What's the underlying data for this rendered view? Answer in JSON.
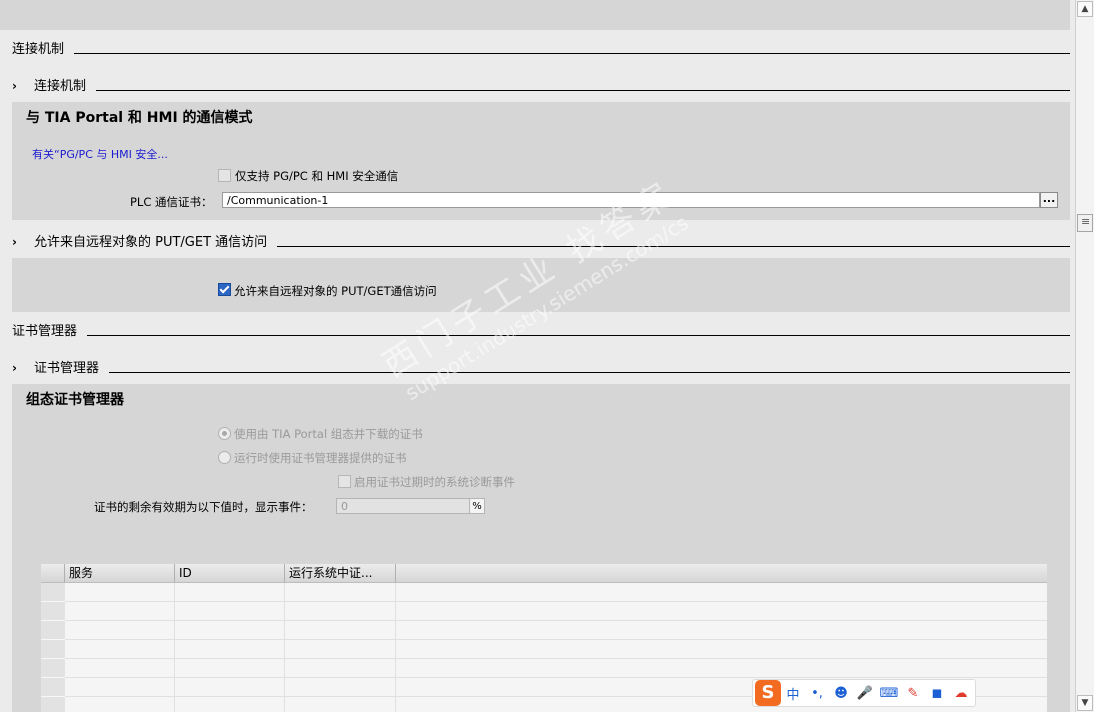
{
  "sections": {
    "connection": {
      "header": "连接机制",
      "subheader": "连接机制",
      "panel_title": "与 TIA Portal 和 HMI 的通信模式",
      "link": "有关“PG/PC 与 HMI 安全...",
      "pgpc_checkbox_label": "仅支持 PG/PC 和 HMI 安全通信",
      "cert_label": "PLC 通信证书：",
      "cert_value": "/Communication-1",
      "browse": "..."
    },
    "putget": {
      "subheader": "允许来自远程对象的 PUT/GET 通信访问",
      "checkbox_label": "允许来自远程对象的 PUT/GET通信访问",
      "checked": true
    },
    "certmgr": {
      "header": "证书管理器",
      "subheader": "证书管理器",
      "panel_title": "组态证书管理器",
      "radio1": "使用由 TIA Portal 组态并下载的证书",
      "radio2": "运行时使用证书管理器提供的证书",
      "diag_checkbox": "启用证书过期时的系统诊断事件",
      "remain_label": "证书的剩余有效期为以下值时，显示事件：",
      "remain_value": "0",
      "unit": "%"
    }
  },
  "table": {
    "columns": [
      "服务",
      "ID",
      "运行系统中证..."
    ],
    "row_count": 7
  },
  "watermark": {
    "line1": "西门子工业   找答案",
    "line2": "support.industry.siemens.com/cs"
  },
  "ime": {
    "logo": "S",
    "mode": "中",
    "punct": "•,",
    "emoji": "☻",
    "mic": "🎤",
    "keyboard": "⌨",
    "skin": "✎",
    "apps": "◼",
    "extra": "☁"
  },
  "scrollbar": {
    "up": "▲",
    "down": "▼"
  }
}
